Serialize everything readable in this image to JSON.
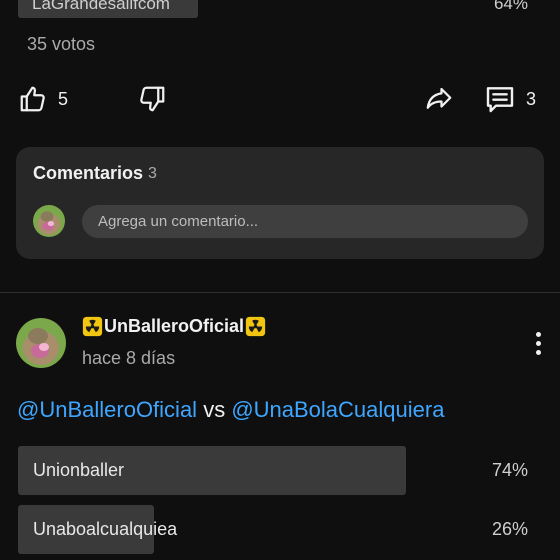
{
  "previous_poll": {
    "option_label": "LaGrandesalifcom",
    "option_percent": "64%",
    "votes": "35 votos"
  },
  "actions": {
    "likes": "5",
    "comments": "3"
  },
  "comments_section": {
    "title": "Comentarios",
    "count": "3",
    "input_placeholder": "Agrega un comentario..."
  },
  "post": {
    "author": "UnBalleroOficial",
    "author_badge_icon": "radioactive-icon",
    "timestamp": "hace 8 días",
    "text": {
      "mention1": "@UnBalleroOficial",
      "connector": "vs",
      "mention2": "@UnaBolaCualquiera"
    },
    "poll": [
      {
        "label": "Unionballer",
        "percent": "74%",
        "value": 0.74
      },
      {
        "label": "Unaboalcualquiea",
        "percent": "26%",
        "value": 0.26
      }
    ]
  },
  "colors": {
    "background": "#0f0f0f",
    "card": "#272727",
    "mention": "#3ea6ff",
    "poll_fill": "#3a3a3a",
    "radioactive": "#f2c511"
  }
}
